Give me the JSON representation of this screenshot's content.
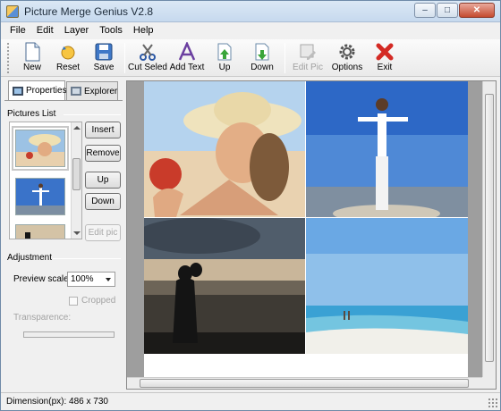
{
  "window": {
    "title": "Picture Merge Genius V2.8"
  },
  "menu": [
    "File",
    "Edit",
    "Layer",
    "Tools",
    "Help"
  ],
  "toolbar": {
    "new": "New",
    "reset": "Reset",
    "save": "Save",
    "cut": "Cut Seled",
    "add_text": "Add Text",
    "up": "Up",
    "down": "Down",
    "edit_pic": "Edit Pic",
    "options": "Options",
    "exit": "Exit"
  },
  "tabs": {
    "properties": "Properties",
    "explorer": "Explorer"
  },
  "pictures_list": {
    "title": "Pictures List",
    "buttons": {
      "insert": "Insert",
      "remove": "Remove",
      "up": "Up",
      "down": "Down",
      "edit_pic": "Edit pic"
    }
  },
  "adjustment": {
    "title": "Adjustment",
    "preview_scale_label": "Preview scale:",
    "preview_scale_value": "100%",
    "cropped_label": "Cropped",
    "transparence_label": "Transparence:"
  },
  "status": {
    "dimension": "Dimension(px): 486 x 730"
  },
  "colors": {
    "accent": "#3a6ea5",
    "exit_red": "#d42a24",
    "canvas_bg": "#9e9e9e"
  }
}
